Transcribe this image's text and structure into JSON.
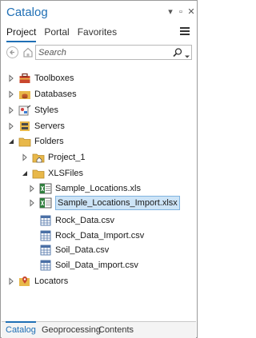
{
  "pane": {
    "title": "Catalog",
    "controls": [
      "▾",
      "▫",
      "✕"
    ]
  },
  "tabs": [
    {
      "label": "Project",
      "active": true
    },
    {
      "label": "Portal",
      "active": false
    },
    {
      "label": "Favorites",
      "active": false
    }
  ],
  "search": {
    "placeholder": "Search",
    "value": ""
  },
  "tree": [
    {
      "label": "Toolboxes",
      "icon": "toolbox-icon",
      "expander": "collapsed",
      "level": 0
    },
    {
      "label": "Databases",
      "icon": "database-icon",
      "expander": "collapsed",
      "level": 0
    },
    {
      "label": "Styles",
      "icon": "styles-icon",
      "expander": "collapsed",
      "level": 0
    },
    {
      "label": "Servers",
      "icon": "servers-icon",
      "expander": "collapsed",
      "level": 0
    },
    {
      "label": "Folders",
      "icon": "folder-icon",
      "expander": "expanded",
      "level": 0
    },
    {
      "label": "Project_1",
      "icon": "folder-home-icon",
      "expander": "collapsed",
      "level": 1
    },
    {
      "label": "XLSFiles",
      "icon": "folder-icon",
      "expander": "expanded",
      "level": 1
    },
    {
      "label": "Sample_Locations.xls",
      "icon": "excel-workbook-icon",
      "expander": "collapsed",
      "level": 2
    },
    {
      "label": "Sample_Locations_Import.xlsx",
      "icon": "excel-workbook-icon",
      "expander": "collapsed",
      "level": 2,
      "selected": true
    },
    {
      "label": "Rock_Data.csv",
      "icon": "csv-table-icon",
      "expander": "none",
      "level": 2
    },
    {
      "label": "Rock_Data_Import.csv",
      "icon": "csv-table-icon",
      "expander": "none",
      "level": 2
    },
    {
      "label": "Soil_Data.csv",
      "icon": "csv-table-icon",
      "expander": "none",
      "level": 2
    },
    {
      "label": "Soil_Data_import.csv",
      "icon": "csv-table-icon",
      "expander": "none",
      "level": 2
    },
    {
      "label": "Locators",
      "icon": "locator-icon",
      "expander": "collapsed",
      "level": 0
    }
  ],
  "bottom_tabs": [
    {
      "label": "Catalog",
      "active": true
    },
    {
      "label": "Geoprocessing",
      "active": false
    },
    {
      "label": "Contents",
      "active": false
    }
  ],
  "colors": {
    "accent": "#1f6fb5",
    "selection_bg": "#cde4f7",
    "folder": "#e8b84a",
    "excel": "#2e7d3c"
  }
}
